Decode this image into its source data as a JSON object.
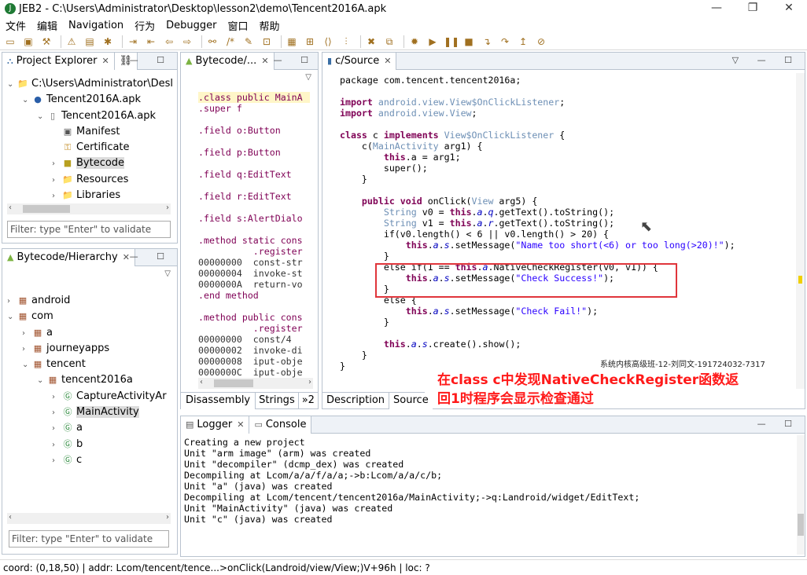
{
  "window": {
    "title": "JEB2 - C:\\Users\\Administrator\\Desktop\\lesson2\\demo\\Tencent2016A.apk",
    "min": "—",
    "max": "❐",
    "close": "✕"
  },
  "menu": [
    "文件",
    "编辑",
    "Navigation",
    "行为",
    "Debugger",
    "窗口",
    "帮助"
  ],
  "project_explorer": {
    "tab": "Project Explorer",
    "tab2": "⛓",
    "items": [
      {
        "arrow": "⌄",
        "label": "C:\\Users\\Administrator\\Desl",
        "icon": "folder-icon",
        "depth": 0
      },
      {
        "arrow": "⌄",
        "label": "Tencent2016A.apk",
        "icon": "bullet-icon",
        "depth": 1
      },
      {
        "arrow": "⌄",
        "label": "Tencent2016A.apk",
        "icon": "apk-icon",
        "depth": 2
      },
      {
        "arrow": "",
        "label": "Manifest",
        "icon": "manifest-icon",
        "depth": 3
      },
      {
        "arrow": "",
        "label": "Certificate",
        "icon": "certificate-icon",
        "depth": 3
      },
      {
        "arrow": "›",
        "label": "Bytecode",
        "icon": "bytecode-icon",
        "depth": 3
      },
      {
        "arrow": "›",
        "label": "Resources",
        "icon": "folder-icon",
        "depth": 3
      },
      {
        "arrow": "›",
        "label": "Libraries",
        "icon": "folder-icon",
        "depth": 3
      }
    ],
    "filter": "Filter: type \"Enter\" to validate"
  },
  "hierarchy": {
    "tab": "Bytecode/Hierarchy",
    "items": [
      {
        "arrow": "›",
        "label": "android",
        "icon": "package-icon",
        "depth": 0
      },
      {
        "arrow": "⌄",
        "label": "com",
        "icon": "package-icon",
        "depth": 0
      },
      {
        "arrow": "›",
        "label": "a",
        "icon": "package-icon",
        "depth": 1
      },
      {
        "arrow": "›",
        "label": "journeyapps",
        "icon": "package-icon",
        "depth": 1
      },
      {
        "arrow": "⌄",
        "label": "tencent",
        "icon": "package-icon",
        "depth": 1
      },
      {
        "arrow": "⌄",
        "label": "tencent2016a",
        "icon": "package-icon",
        "depth": 2
      },
      {
        "arrow": "›",
        "label": "CaptureActivityAr",
        "icon": "class-icon",
        "depth": 3
      },
      {
        "arrow": "›",
        "label": "MainActivity",
        "icon": "class-icon",
        "depth": 3
      },
      {
        "arrow": "›",
        "label": "a",
        "icon": "class-icon",
        "depth": 3
      },
      {
        "arrow": "›",
        "label": "b",
        "icon": "class-icon",
        "depth": 3
      },
      {
        "arrow": "›",
        "label": "c",
        "icon": "class-icon",
        "depth": 3
      }
    ],
    "filter": "Filter: type \"Enter\" to validate"
  },
  "bytecode": {
    "tab": "Bytecode/...",
    "lines": [
      ".class public MainA",
      ".super f",
      "",
      ".field o:Button",
      "",
      ".field p:Button",
      "",
      ".field q:EditText",
      "",
      ".field r:EditText",
      "",
      ".field s:AlertDialo",
      "",
      ".method static cons",
      "          .register",
      "00000000  const-str",
      "00000004  invoke-st",
      "0000000A  return-vo",
      ".end method",
      "",
      ".method public cons",
      "          .register",
      "00000000  const/4",
      "00000002  invoke-di",
      "00000008  iput-obje",
      "0000000C  iput-obje"
    ],
    "bottom_tabs": [
      "Disassembly",
      "Strings",
      "»2"
    ]
  },
  "source": {
    "tab": "c/Source",
    "lines": [
      [
        [
          "p",
          "package com.tencent.tencent2016a;"
        ]
      ],
      [],
      [
        [
          "k",
          "import "
        ],
        [
          "t",
          "android.view.View$OnClickListener"
        ],
        [
          "p",
          ";"
        ]
      ],
      [
        [
          "k",
          "import "
        ],
        [
          "t",
          "android.view.View"
        ],
        [
          "p",
          ";"
        ]
      ],
      [],
      [
        [
          "k",
          "class "
        ],
        [
          "p",
          "c "
        ],
        [
          "k",
          "implements "
        ],
        [
          "t",
          "View$OnClickListener"
        ],
        [
          "p",
          " {"
        ]
      ],
      [
        [
          "p",
          "    c("
        ],
        [
          "t",
          "MainActivity"
        ],
        [
          "p",
          " arg1) {"
        ]
      ],
      [
        [
          "p",
          "        "
        ],
        [
          "k",
          "this"
        ],
        [
          "p",
          ".a = arg1;"
        ]
      ],
      [
        [
          "p",
          "        super();"
        ]
      ],
      [
        [
          "p",
          "    }"
        ]
      ],
      [],
      [
        [
          "p",
          "    "
        ],
        [
          "k",
          "public void "
        ],
        [
          "p",
          "onClick("
        ],
        [
          "t",
          "View"
        ],
        [
          "p",
          " arg5) {"
        ]
      ],
      [
        [
          "p",
          "        "
        ],
        [
          "t",
          "String"
        ],
        [
          "p",
          " v0 = "
        ],
        [
          "k",
          "this"
        ],
        [
          "p",
          "."
        ],
        [
          "f",
          "a"
        ],
        [
          "p",
          "."
        ],
        [
          "f",
          "q"
        ],
        [
          "p",
          ".getText().toString();"
        ]
      ],
      [
        [
          "p",
          "        "
        ],
        [
          "t",
          "String"
        ],
        [
          "p",
          " v1 = "
        ],
        [
          "k",
          "this"
        ],
        [
          "p",
          "."
        ],
        [
          "f",
          "a"
        ],
        [
          "p",
          "."
        ],
        [
          "f",
          "r"
        ],
        [
          "p",
          ".getText().toString();"
        ]
      ],
      [
        [
          "p",
          "        if(v0.length() < 6 || v0.length() > 20) {"
        ]
      ],
      [
        [
          "p",
          "            "
        ],
        [
          "k",
          "this"
        ],
        [
          "p",
          "."
        ],
        [
          "f",
          "a"
        ],
        [
          "p",
          "."
        ],
        [
          "f",
          "s"
        ],
        [
          "p",
          ".setMessage("
        ],
        [
          "s",
          "\"Name too short(<6) or too long(>20)!\""
        ],
        [
          "p",
          ");"
        ]
      ],
      [
        [
          "p",
          "        }"
        ]
      ],
      [
        [
          "p",
          "        else if(1 == "
        ],
        [
          "k",
          "this"
        ],
        [
          "p",
          "."
        ],
        [
          "f",
          "a"
        ],
        [
          "p",
          ".NativeCheckRegister(v0, v1)) {"
        ]
      ],
      [
        [
          "p",
          "            "
        ],
        [
          "k",
          "this"
        ],
        [
          "p",
          "."
        ],
        [
          "f",
          "a"
        ],
        [
          "p",
          "."
        ],
        [
          "f",
          "s"
        ],
        [
          "p",
          ".setMessage("
        ],
        [
          "s",
          "\"Check Success!\""
        ],
        [
          "p",
          ");"
        ]
      ],
      [
        [
          "p",
          "        }"
        ]
      ],
      [
        [
          "p",
          "        else {"
        ]
      ],
      [
        [
          "p",
          "            "
        ],
        [
          "k",
          "this"
        ],
        [
          "p",
          "."
        ],
        [
          "f",
          "a"
        ],
        [
          "p",
          "."
        ],
        [
          "f",
          "s"
        ],
        [
          "p",
          ".setMessage("
        ],
        [
          "s",
          "\"Check Fail!\""
        ],
        [
          "p",
          ");"
        ]
      ],
      [
        [
          "p",
          "        }"
        ]
      ],
      [],
      [
        [
          "p",
          "        "
        ],
        [
          "k",
          "this"
        ],
        [
          "p",
          "."
        ],
        [
          "f",
          "a"
        ],
        [
          "p",
          "."
        ],
        [
          "f",
          "s"
        ],
        [
          "p",
          ".create().show();"
        ]
      ],
      [
        [
          "p",
          "    }"
        ]
      ],
      [
        [
          "p",
          "}"
        ]
      ]
    ],
    "bottom_tabs": [
      "Description",
      "Source"
    ]
  },
  "watermark": "系统内核高级班-12-刘同文-191724032-7317",
  "annotation": [
    "在class c中发现NativeCheckRegister函数返",
    "回1时程序会显示检查通过"
  ],
  "logger": {
    "tabs": [
      "Logger",
      "Console"
    ],
    "lines": [
      "Creating a new project",
      "Unit \"arm image\" (arm) was created",
      "Unit \"decompiler\" (dcmp_dex) was created",
      "Decompiling at Lcom/a/a/f/a/a;->b:Lcom/a/a/c/b;",
      "Unit \"a\" (java) was created",
      "Decompiling at Lcom/tencent/tencent2016a/MainActivity;->q:Landroid/widget/EditText;",
      "Unit \"MainActivity\" (java) was created",
      "Unit \"c\" (java) was created"
    ]
  },
  "status": "coord: (0,18,50) | addr: Lcom/tencent/tence...>onClick(Landroid/view/View;)V+96h | loc: ?",
  "colors": {
    "highlight_box": "#e0353b",
    "annotation": "#ff1a1a"
  }
}
